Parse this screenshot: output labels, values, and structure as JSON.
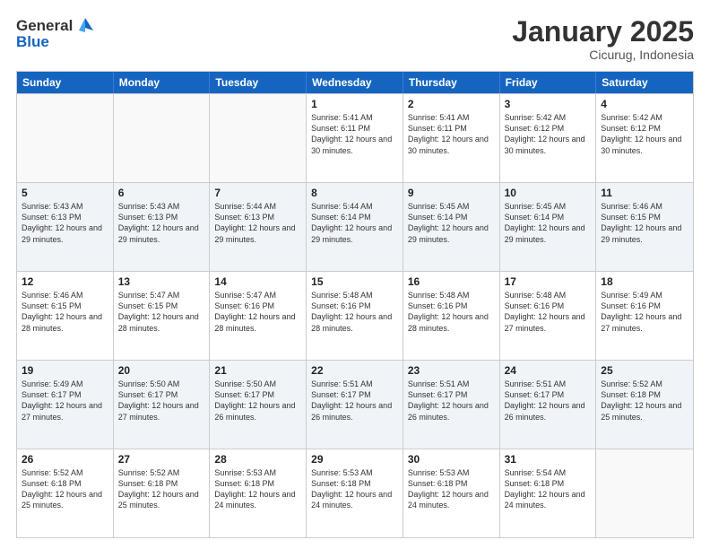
{
  "header": {
    "logo_general": "General",
    "logo_blue": "Blue",
    "month_title": "January 2025",
    "location": "Cicurug, Indonesia"
  },
  "weekdays": [
    "Sunday",
    "Monday",
    "Tuesday",
    "Wednesday",
    "Thursday",
    "Friday",
    "Saturday"
  ],
  "rows": [
    [
      {
        "day": "",
        "info": "",
        "empty": true
      },
      {
        "day": "",
        "info": "",
        "empty": true
      },
      {
        "day": "",
        "info": "",
        "empty": true
      },
      {
        "day": "1",
        "info": "Sunrise: 5:41 AM\nSunset: 6:11 PM\nDaylight: 12 hours and 30 minutes."
      },
      {
        "day": "2",
        "info": "Sunrise: 5:41 AM\nSunset: 6:11 PM\nDaylight: 12 hours and 30 minutes."
      },
      {
        "day": "3",
        "info": "Sunrise: 5:42 AM\nSunset: 6:12 PM\nDaylight: 12 hours and 30 minutes."
      },
      {
        "day": "4",
        "info": "Sunrise: 5:42 AM\nSunset: 6:12 PM\nDaylight: 12 hours and 30 minutes."
      }
    ],
    [
      {
        "day": "5",
        "info": "Sunrise: 5:43 AM\nSunset: 6:13 PM\nDaylight: 12 hours and 29 minutes."
      },
      {
        "day": "6",
        "info": "Sunrise: 5:43 AM\nSunset: 6:13 PM\nDaylight: 12 hours and 29 minutes."
      },
      {
        "day": "7",
        "info": "Sunrise: 5:44 AM\nSunset: 6:13 PM\nDaylight: 12 hours and 29 minutes."
      },
      {
        "day": "8",
        "info": "Sunrise: 5:44 AM\nSunset: 6:14 PM\nDaylight: 12 hours and 29 minutes."
      },
      {
        "day": "9",
        "info": "Sunrise: 5:45 AM\nSunset: 6:14 PM\nDaylight: 12 hours and 29 minutes."
      },
      {
        "day": "10",
        "info": "Sunrise: 5:45 AM\nSunset: 6:14 PM\nDaylight: 12 hours and 29 minutes."
      },
      {
        "day": "11",
        "info": "Sunrise: 5:46 AM\nSunset: 6:15 PM\nDaylight: 12 hours and 29 minutes."
      }
    ],
    [
      {
        "day": "12",
        "info": "Sunrise: 5:46 AM\nSunset: 6:15 PM\nDaylight: 12 hours and 28 minutes."
      },
      {
        "day": "13",
        "info": "Sunrise: 5:47 AM\nSunset: 6:15 PM\nDaylight: 12 hours and 28 minutes."
      },
      {
        "day": "14",
        "info": "Sunrise: 5:47 AM\nSunset: 6:16 PM\nDaylight: 12 hours and 28 minutes."
      },
      {
        "day": "15",
        "info": "Sunrise: 5:48 AM\nSunset: 6:16 PM\nDaylight: 12 hours and 28 minutes."
      },
      {
        "day": "16",
        "info": "Sunrise: 5:48 AM\nSunset: 6:16 PM\nDaylight: 12 hours and 28 minutes."
      },
      {
        "day": "17",
        "info": "Sunrise: 5:48 AM\nSunset: 6:16 PM\nDaylight: 12 hours and 27 minutes."
      },
      {
        "day": "18",
        "info": "Sunrise: 5:49 AM\nSunset: 6:16 PM\nDaylight: 12 hours and 27 minutes."
      }
    ],
    [
      {
        "day": "19",
        "info": "Sunrise: 5:49 AM\nSunset: 6:17 PM\nDaylight: 12 hours and 27 minutes."
      },
      {
        "day": "20",
        "info": "Sunrise: 5:50 AM\nSunset: 6:17 PM\nDaylight: 12 hours and 27 minutes."
      },
      {
        "day": "21",
        "info": "Sunrise: 5:50 AM\nSunset: 6:17 PM\nDaylight: 12 hours and 26 minutes."
      },
      {
        "day": "22",
        "info": "Sunrise: 5:51 AM\nSunset: 6:17 PM\nDaylight: 12 hours and 26 minutes."
      },
      {
        "day": "23",
        "info": "Sunrise: 5:51 AM\nSunset: 6:17 PM\nDaylight: 12 hours and 26 minutes."
      },
      {
        "day": "24",
        "info": "Sunrise: 5:51 AM\nSunset: 6:17 PM\nDaylight: 12 hours and 26 minutes."
      },
      {
        "day": "25",
        "info": "Sunrise: 5:52 AM\nSunset: 6:18 PM\nDaylight: 12 hours and 25 minutes."
      }
    ],
    [
      {
        "day": "26",
        "info": "Sunrise: 5:52 AM\nSunset: 6:18 PM\nDaylight: 12 hours and 25 minutes."
      },
      {
        "day": "27",
        "info": "Sunrise: 5:52 AM\nSunset: 6:18 PM\nDaylight: 12 hours and 25 minutes."
      },
      {
        "day": "28",
        "info": "Sunrise: 5:53 AM\nSunset: 6:18 PM\nDaylight: 12 hours and 24 minutes."
      },
      {
        "day": "29",
        "info": "Sunrise: 5:53 AM\nSunset: 6:18 PM\nDaylight: 12 hours and 24 minutes."
      },
      {
        "day": "30",
        "info": "Sunrise: 5:53 AM\nSunset: 6:18 PM\nDaylight: 12 hours and 24 minutes."
      },
      {
        "day": "31",
        "info": "Sunrise: 5:54 AM\nSunset: 6:18 PM\nDaylight: 12 hours and 24 minutes."
      },
      {
        "day": "",
        "info": "",
        "empty": true
      }
    ]
  ]
}
